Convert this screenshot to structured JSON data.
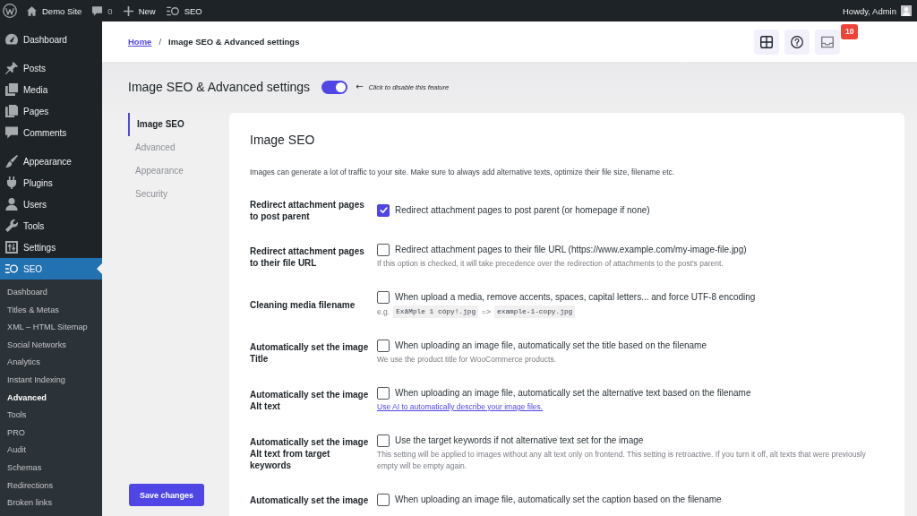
{
  "admin_bar": {
    "items": [
      {
        "kind": "logo"
      },
      {
        "kind": "home",
        "label": "Demo Site"
      },
      {
        "kind": "comments",
        "label": "0"
      },
      {
        "kind": "new",
        "label": "New"
      },
      {
        "kind": "seo",
        "label": "SEO"
      }
    ],
    "account": "Howdy, Admin"
  },
  "sidebar": {
    "groups": [
      {
        "items": [
          {
            "kind": "dashboard",
            "label": "Dashboard",
            "selected": false
          }
        ]
      },
      {
        "items": [
          {
            "kind": "posts",
            "label": "Posts",
            "selected": false
          },
          {
            "kind": "media",
            "label": "Media",
            "selected": false
          },
          {
            "kind": "pages",
            "label": "Pages",
            "selected": false
          },
          {
            "kind": "comments",
            "label": "Comments",
            "selected": false
          }
        ]
      },
      {
        "items": [
          {
            "kind": "appearance",
            "label": "Appearance",
            "selected": false
          },
          {
            "kind": "plugins",
            "label": "Plugins",
            "selected": false
          },
          {
            "kind": "users",
            "label": "Users",
            "selected": false
          },
          {
            "kind": "tools",
            "label": "Tools",
            "selected": false
          },
          {
            "kind": "settings",
            "label": "Settings",
            "selected": false
          },
          {
            "kind": "seo",
            "label": "SEO",
            "selected": true,
            "children": [
              {
                "label": "Dashboard",
                "selected": false
              },
              {
                "label": "Titles & Metas",
                "selected": false
              },
              {
                "label": "XML – HTML Sitemap",
                "selected": false
              },
              {
                "label": "Social Networks",
                "selected": false
              },
              {
                "label": "Analytics",
                "selected": false
              },
              {
                "label": "Instant Indexing",
                "selected": false
              },
              {
                "label": "Advanced",
                "selected": true
              },
              {
                "label": "Tools",
                "selected": false
              },
              {
                "label": "PRO",
                "selected": false
              },
              {
                "label": "Audit",
                "selected": false
              },
              {
                "label": "Schemas",
                "selected": false
              },
              {
                "label": "Redirections",
                "selected": false
              },
              {
                "label": "Broken links",
                "selected": false
              }
            ]
          }
        ]
      }
    ]
  },
  "header": {
    "breadcrumb": [
      {
        "kind": "link",
        "label": "Home"
      },
      {
        "kind": "current",
        "label": "Image SEO & Advanced settings"
      }
    ],
    "separator": "/",
    "buttons": [
      {
        "kind": "apps"
      },
      {
        "kind": "help"
      },
      {
        "kind": "notifications",
        "badge": "10"
      }
    ]
  },
  "page": {
    "title": "Image SEO & Advanced settings",
    "enabled": true,
    "toggle_arrow": "←",
    "toggle_hint": "Click to disable this feature",
    "tabs": [
      {
        "label": "Image SEO",
        "selected": true
      },
      {
        "label": "Advanced",
        "selected": false
      },
      {
        "label": "Appearance",
        "selected": false
      },
      {
        "label": "Security",
        "selected": false
      }
    ],
    "save_button": "Save changes",
    "section": {
      "title": "Image SEO",
      "description": "Images can generate a lot of traffic to your site. Make sure to always add alternative texts, optimize their file size, filename etc.",
      "settings": [
        {
          "label": "Redirect attachment pages to post parent",
          "checked": true,
          "text": "Redirect attachment pages to post parent (or homepage if none)"
        },
        {
          "label": "Redirect attachment pages to their file URL",
          "checked": false,
          "text": "Redirect attachment pages to their file URL (https://www.example.com/my-image-file.jpg)",
          "hint": "If this option is checked, it will take precedence over the redirection of attachments to the post's parent."
        },
        {
          "label": "Cleaning media filename",
          "checked": false,
          "text": "When upload a media, remove accents, spaces, capital letters... and force UTF-8 encoding",
          "example": {
            "prefix": "e.g.",
            "before": "ExãMple 1 cópy!.jpg",
            "arrow": "=>",
            "after": "example-1-copy.jpg"
          }
        },
        {
          "label": "Automatically set the image Title",
          "checked": false,
          "text": "When uploading an image file, automatically set the title based on the filename",
          "hint": "We use the product title for WooCommerce products."
        },
        {
          "label": "Automatically set the image Alt text",
          "checked": false,
          "text": "When uploading an image file, automatically set the alternative text based on the filename",
          "link": "Use AI to automatically describe your image files."
        },
        {
          "label": "Automatically set the image Alt text from target keywords",
          "checked": false,
          "text": "Use the target keywords if not alternative text set for the image",
          "hint": "This setting will be applied to images without any alt text only on frontend. This setting is retroactive. If you turn it off, alt texts that were previously empty will be empty again."
        },
        {
          "label": "Automatically set the image",
          "checked": false,
          "text": "When uploading an image file, automatically set the caption based on the filename"
        }
      ]
    }
  }
}
